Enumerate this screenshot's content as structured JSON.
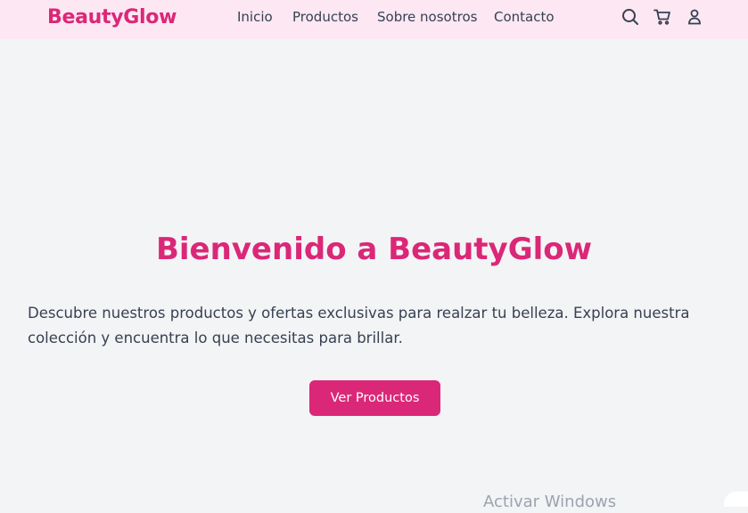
{
  "header": {
    "logo": "BeautyGlow",
    "nav": [
      "Inicio",
      "Productos",
      "Sobre nosotros",
      "Contacto"
    ],
    "icons": [
      "search-icon",
      "cart-icon",
      "user-icon"
    ]
  },
  "hero": {
    "title": "Bienvenido a BeautyGlow",
    "text": "Descubre nuestros productos y ofertas exclusivas para realzar tu belleza. Explora nuestra colección y encuentra lo que necesitas para brillar.",
    "button": "Ver Productos"
  },
  "watermark": "Activar Windows",
  "colors": {
    "brand": "#db2777",
    "header_bg": "#fce7f3",
    "page_bg": "#f3f4f6",
    "text": "#374151"
  }
}
